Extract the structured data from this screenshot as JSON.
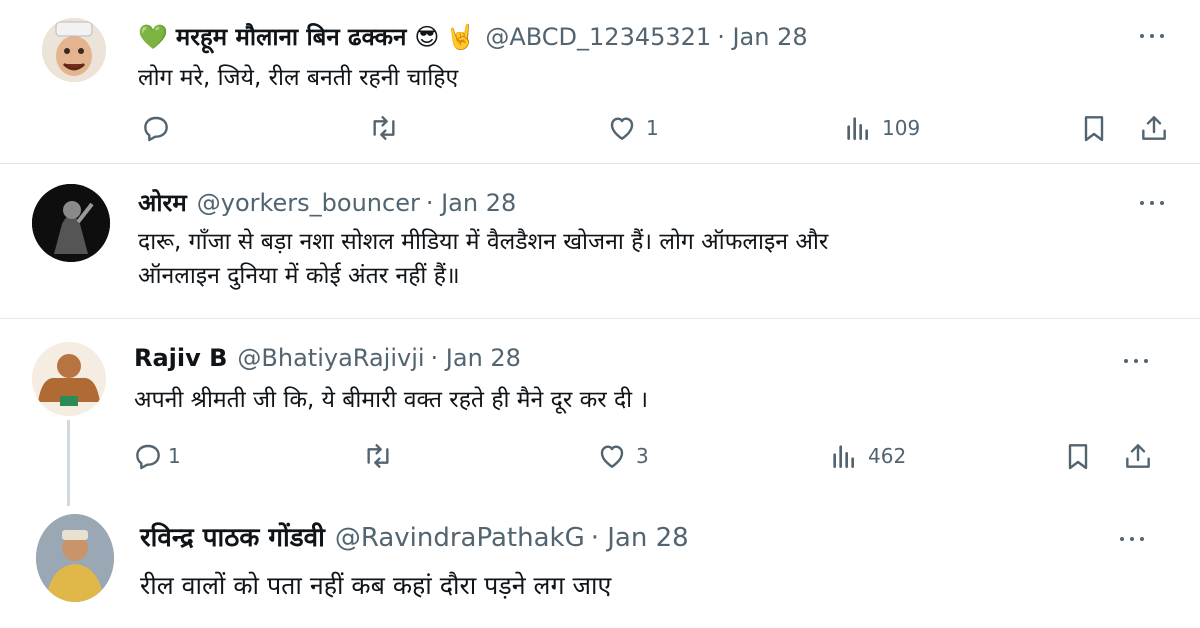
{
  "tweets": [
    {
      "name": "मरहूम मौलाना बिन ढक्कन",
      "emojis": "💚 😎 🤘",
      "handle": "@ABCD_12345321",
      "date": "· Jan 28",
      "text": "लोग मरे, जिये, रील बनती रहनी चाहिए",
      "replies": "",
      "likes": "1",
      "views": "109"
    },
    {
      "name": "ओरम",
      "handle": "@yorkers_bouncer",
      "date": "· Jan 28",
      "text_line1": "दारू, गाँजा से बड़ा नशा सोशल मीडिया में  वैलडैशन खोजना हैं। लोग ऑफलाइन और",
      "text_line2": "ऑनलाइन दुनिया में कोई अंतर नहीं हैं॥"
    },
    {
      "name": "Rajiv B",
      "handle": "@BhatiyaRajivji",
      "date": "· Jan 28",
      "text": "अपनी श्रीमती जी कि, ये बीमारी वक्त रहते  ही मैने दूर कर दी ।",
      "replies": "1",
      "likes": "3",
      "views": "462"
    },
    {
      "name": "रविन्द्र पाठक गोंडवी",
      "handle": "@RavindraPathakG",
      "date": "· Jan 28",
      "text": "रील वालों को पता नहीं कब कहां दौरा पड़ने लग जाए"
    }
  ],
  "colors": {
    "text": "#0f1419",
    "muted": "#536471",
    "divider": "#dde3e8",
    "green_heart": "#43a047"
  },
  "icons": [
    "reply-icon",
    "retweet-icon",
    "like-icon",
    "views-icon",
    "bookmark-icon",
    "share-icon",
    "more-icon"
  ]
}
